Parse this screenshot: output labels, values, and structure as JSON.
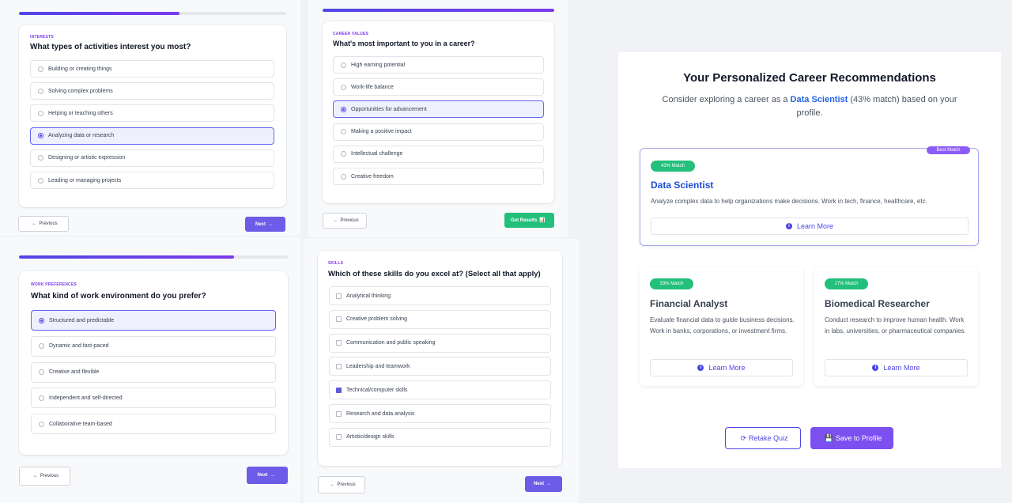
{
  "q1": {
    "kicker": "INTERESTS",
    "question": "What types of activities interest you most?",
    "progress": 0.6,
    "options": [
      {
        "label": "Building or creating things",
        "selected": false
      },
      {
        "label": "Solving complex problems",
        "selected": false
      },
      {
        "label": "Helping or teaching others",
        "selected": false
      },
      {
        "label": "Analyzing data or research",
        "selected": true
      },
      {
        "label": "Designing or artistic expression",
        "selected": false
      },
      {
        "label": "Leading or managing projects",
        "selected": false
      }
    ],
    "prev_label": "Previous",
    "next_label": "Next"
  },
  "q2": {
    "kicker": "CAREER VALUES",
    "question": "What's most important to you in a career?",
    "progress": 1.0,
    "options": [
      {
        "label": "High earning potential",
        "selected": false
      },
      {
        "label": "Work-life balance",
        "selected": false
      },
      {
        "label": "Opportunities for advancement",
        "selected": true
      },
      {
        "label": "Making a positive impact",
        "selected": false
      },
      {
        "label": "Intellectual challenge",
        "selected": false
      },
      {
        "label": "Creative freedom",
        "selected": false
      }
    ],
    "prev_label": "Previous",
    "results_label": "Get Results"
  },
  "q3": {
    "kicker": "WORK PREFERENCES",
    "question": "What kind of work environment do you prefer?",
    "progress": 0.8,
    "options": [
      {
        "label": "Structured and predictable",
        "selected": true
      },
      {
        "label": "Dynamic and fast-paced",
        "selected": false
      },
      {
        "label": "Creative and flexible",
        "selected": false
      },
      {
        "label": "Independent and self-directed",
        "selected": false
      },
      {
        "label": "Collaborative team-based",
        "selected": false
      }
    ],
    "prev_label": "Previous",
    "next_label": "Next"
  },
  "q4": {
    "kicker": "SKILLS",
    "question": "Which of these skills do you excel at? (Select all that apply)",
    "options": [
      {
        "label": "Analytical thinking",
        "checked": false
      },
      {
        "label": "Creative problem solving",
        "checked": false
      },
      {
        "label": "Communication and public speaking",
        "checked": false
      },
      {
        "label": "Leadership and teamwork",
        "checked": false
      },
      {
        "label": "Technical/computer skills",
        "checked": true
      },
      {
        "label": "Research and data analysis",
        "checked": false
      },
      {
        "label": "Artistic/design skills",
        "checked": false
      }
    ],
    "prev_label": "Previous",
    "next_label": "Next"
  },
  "results": {
    "title": "Your Personalized Career Recommendations",
    "sub_before": "Consider exploring a career as a ",
    "sub_highlight": "Data Scientist",
    "sub_after": " (43% match) based on your profile.",
    "top": {
      "badge": "Best Match",
      "match": "43% Match",
      "name": "Data Scientist",
      "desc": "Analyze complex data to help organizations make decisions. Work in tech, finance, healthcare, etc.",
      "learn": "Learn More"
    },
    "second": {
      "match": "33% Match",
      "name": "Financial Analyst",
      "desc": "Evaluate financial data to guide business decisions. Work in banks, corporations, or investment firms.",
      "learn": "Learn More"
    },
    "third": {
      "match": "17% Match",
      "name": "Biomedical Researcher",
      "desc": "Conduct research to improve human health. Work in labs, universities, or pharmaceutical companies.",
      "learn": "Learn More"
    },
    "retake_label": "Retake Quiz",
    "save_label": "Save to Profile"
  },
  "colors": {
    "accent": "#6d5ce8",
    "match_green": "#22c07a",
    "link_blue": "#2563eb"
  }
}
